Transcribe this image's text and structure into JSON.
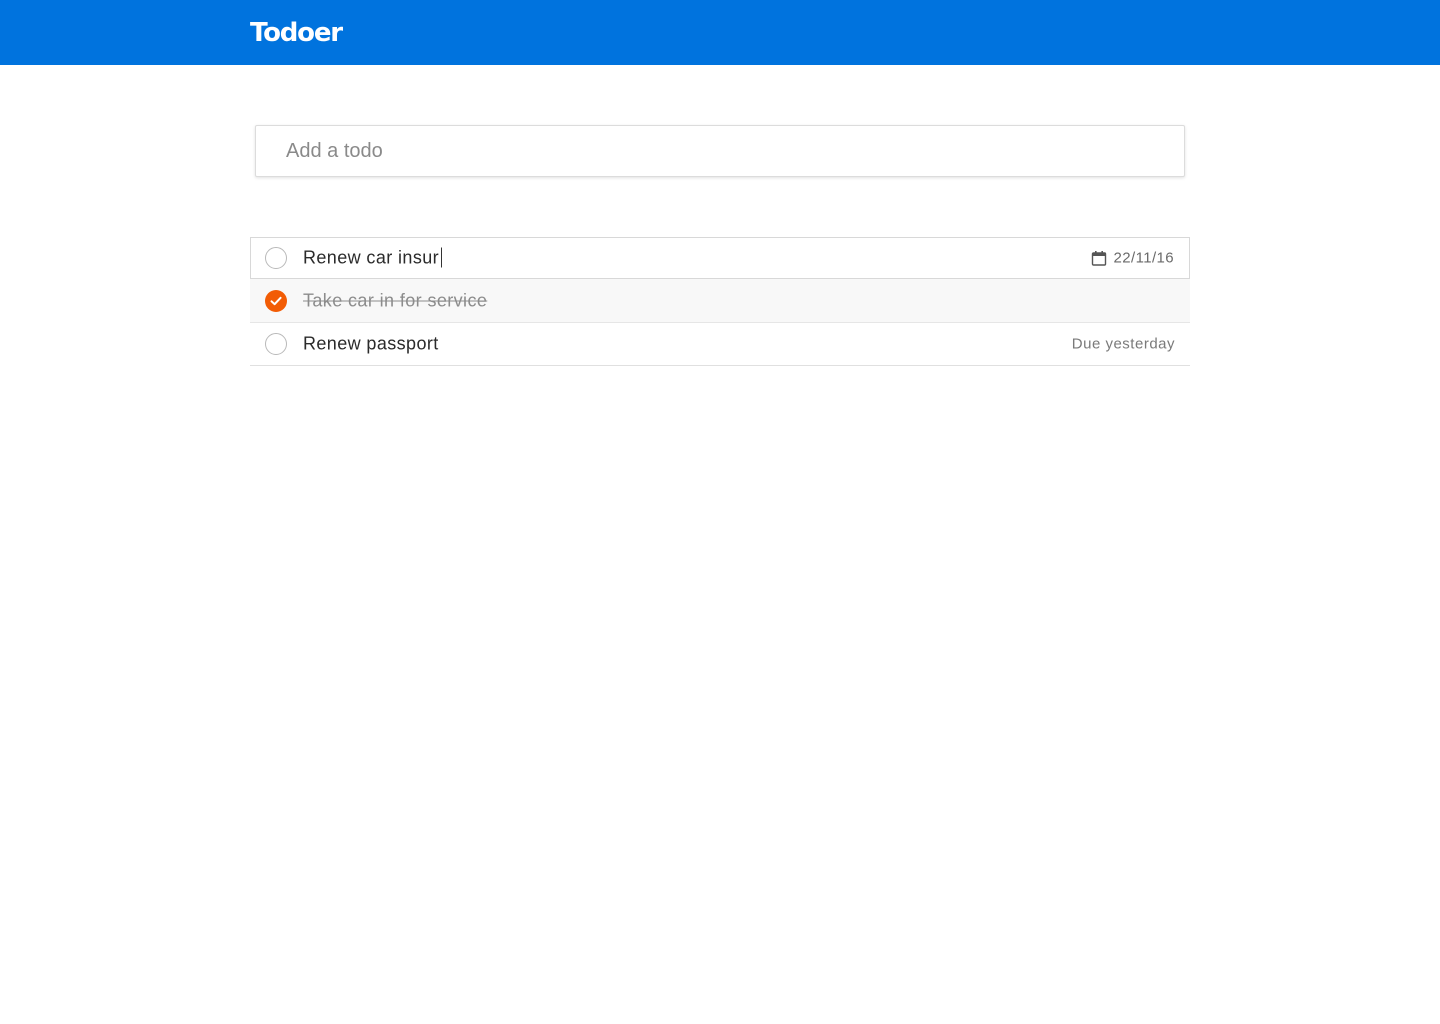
{
  "app": {
    "name": "Todoer"
  },
  "add_todo": {
    "placeholder": "Add a todo",
    "value": ""
  },
  "todos": [
    {
      "text": "Renew car insur",
      "completed": false,
      "editing": true,
      "due_label": "22/11/16",
      "due_icon": "calendar-icon"
    },
    {
      "text": "Take car in for service",
      "completed": true,
      "editing": false,
      "due_label": ""
    },
    {
      "text": "Renew passport",
      "completed": false,
      "editing": false,
      "due_label": "Due yesterday"
    }
  ],
  "colors": {
    "header": "#0073de",
    "accent_complete": "#f25c05",
    "background": "#ffffff"
  }
}
